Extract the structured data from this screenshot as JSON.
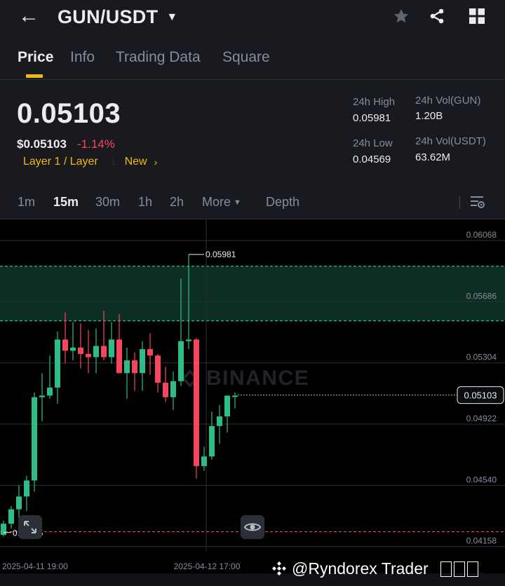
{
  "header": {
    "pair": "GUN/USDT",
    "back_icon": "back-arrow-icon",
    "caret_icon": "caret-down-icon",
    "icons": [
      "star-icon",
      "share-icon",
      "grid-icon"
    ]
  },
  "tabs": [
    {
      "label": "Price",
      "active": true
    },
    {
      "label": "Info"
    },
    {
      "label": "Trading Data"
    },
    {
      "label": "Square"
    }
  ],
  "ticker": {
    "last_price": "0.05103",
    "usd_price": "$0.05103",
    "change": "-1.14%",
    "tag": "Layer 1 / Layer",
    "badge": "New",
    "badge_arrow": "›",
    "high_label": "24h High",
    "high": "0.05981",
    "low_label": "24h Low",
    "low": "0.04569",
    "vol_base_label": "24h Vol(GUN)",
    "vol_base": "1.20B",
    "vol_quote_label": "24h Vol(USDT)",
    "vol_quote": "63.62M"
  },
  "intervals": {
    "items": [
      "1m",
      "15m",
      "30m",
      "1h",
      "2h"
    ],
    "active": "15m",
    "more": "More",
    "depth": "Depth"
  },
  "chart_data": {
    "type": "candlestick",
    "watermark": "BINANCE",
    "y_ticks": [
      "0.06068",
      "0.05686",
      "0.05304",
      "0.04922",
      "0.04540",
      "0.04158"
    ],
    "ylim": [
      0.0413,
      0.062
    ],
    "x_labels": [
      "2025-04-11 19:00",
      "2025-04-12 17:00"
    ],
    "current_price": "0.05103",
    "high_marker": "0.05981",
    "low_marker": "0.04245",
    "zones": [
      {
        "from": 0.05567,
        "to": 0.05908,
        "color": "#0d2e22"
      }
    ],
    "red_line": 0.0425,
    "candles": [
      [
        0.0423,
        0.0432,
        0.0422,
        0.043
      ],
      [
        0.043,
        0.0441,
        0.0427,
        0.0439
      ],
      [
        0.0439,
        0.0454,
        0.0431,
        0.0447
      ],
      [
        0.0447,
        0.046,
        0.0438,
        0.0457
      ],
      [
        0.0457,
        0.0512,
        0.045,
        0.0509
      ],
      [
        0.0509,
        0.0524,
        0.0494,
        0.051
      ],
      [
        0.051,
        0.0535,
        0.0508,
        0.0515
      ],
      [
        0.0515,
        0.055,
        0.0505,
        0.0545
      ],
      [
        0.0545,
        0.0562,
        0.053,
        0.0538
      ],
      [
        0.0538,
        0.0556,
        0.0532,
        0.054
      ],
      [
        0.054,
        0.0555,
        0.0527,
        0.0536
      ],
      [
        0.0536,
        0.0551,
        0.0524,
        0.0534
      ],
      [
        0.0534,
        0.0552,
        0.0524,
        0.0541
      ],
      [
        0.0541,
        0.0563,
        0.0532,
        0.0534
      ],
      [
        0.0534,
        0.0556,
        0.053,
        0.0545
      ],
      [
        0.0545,
        0.0561,
        0.0533,
        0.0524
      ],
      [
        0.0524,
        0.054,
        0.0508,
        0.0532
      ],
      [
        0.0532,
        0.0537,
        0.0513,
        0.0524
      ],
      [
        0.0524,
        0.0544,
        0.0513,
        0.0539
      ],
      [
        0.0539,
        0.0549,
        0.0523,
        0.0535
      ],
      [
        0.0535,
        0.0536,
        0.0512,
        0.0518
      ],
      [
        0.0518,
        0.0528,
        0.0506,
        0.0509
      ],
      [
        0.0509,
        0.0525,
        0.0501,
        0.0519
      ],
      [
        0.0519,
        0.0583,
        0.0516,
        0.0544
      ],
      [
        0.0544,
        0.0598,
        0.0539,
        0.0545
      ],
      [
        0.0545,
        0.0546,
        0.0458,
        0.0466
      ],
      [
        0.0466,
        0.0478,
        0.0463,
        0.0472
      ],
      [
        0.0472,
        0.05,
        0.047,
        0.0491
      ],
      [
        0.0491,
        0.0504,
        0.048,
        0.0497
      ],
      [
        0.0497,
        0.0503,
        0.0487,
        0.051
      ],
      [
        0.051,
        0.0512,
        0.0502,
        0.051
      ]
    ]
  },
  "credit": "@Ryndorex Trader",
  "colors": {
    "up": "#2ebd85",
    "down": "#f6465d",
    "accent": "#f0b90b"
  }
}
